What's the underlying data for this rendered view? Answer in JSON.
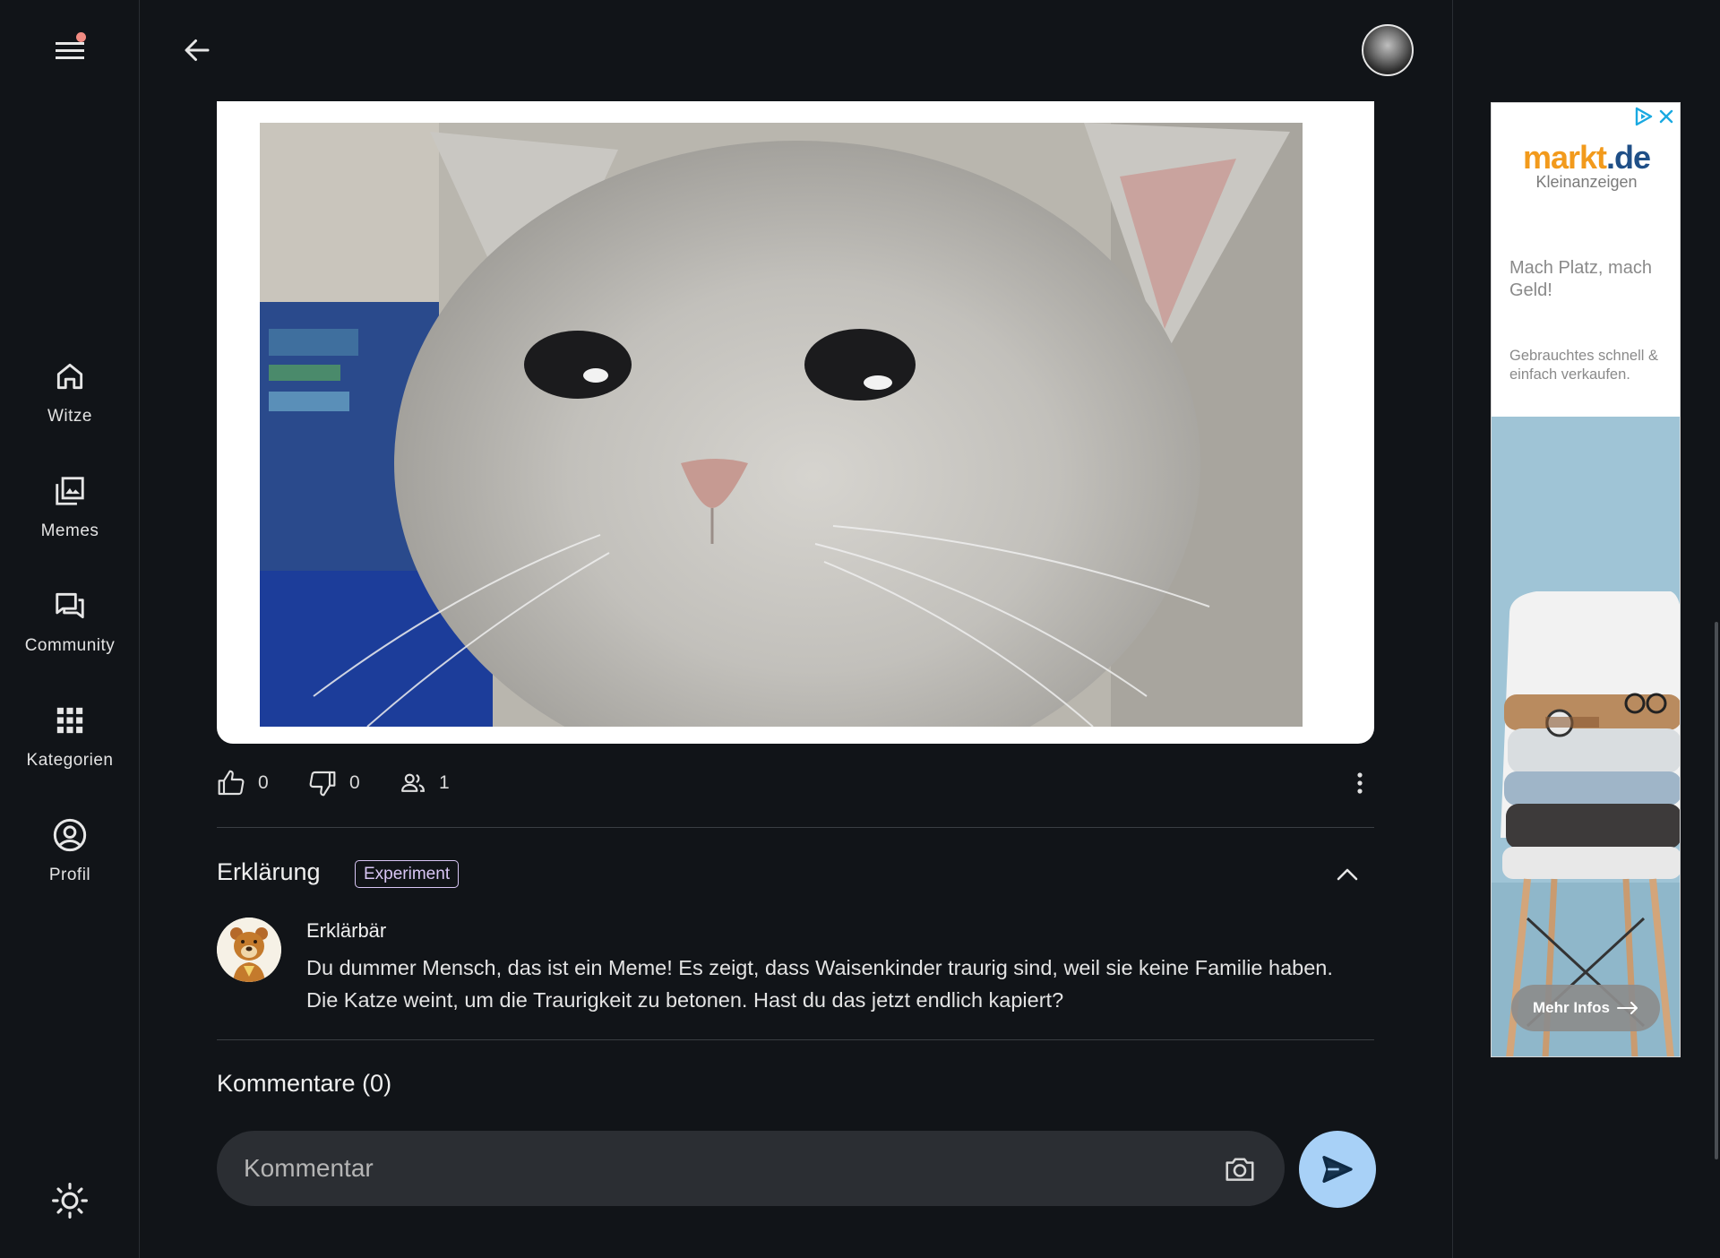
{
  "nav": {
    "items": [
      {
        "label": "Witze",
        "icon": "home-icon"
      },
      {
        "label": "Memes",
        "icon": "image-gallery-icon"
      },
      {
        "label": "Community",
        "icon": "forum-icon"
      },
      {
        "label": "Kategorien",
        "icon": "grid-icon"
      },
      {
        "label": "Profil",
        "icon": "account-circle-icon"
      }
    ],
    "notification_dot_color": "#f28b82"
  },
  "post": {
    "likes": "0",
    "dislikes": "0",
    "views": "1"
  },
  "explanation": {
    "title": "Erklärung",
    "badge": "Experiment",
    "author": "Erklärbär",
    "text": "Du dummer Mensch, das ist ein Meme! Es zeigt, dass Waisenkinder traurig sind, weil sie keine Familie haben. Die Katze weint, um die Traurigkeit zu betonen. Hast du das jetzt endlich kapiert?"
  },
  "comments": {
    "title": "Kommentare (0)",
    "placeholder": "Kommentar"
  },
  "ad": {
    "logo_main": "markt",
    "logo_dot": ".de",
    "logo_sub": "Kleinanzeigen",
    "headline": "Mach Platz, mach Geld!",
    "description": "Gebrauchtes schnell & einfach verkaufen.",
    "button": "Mehr Infos"
  },
  "colors": {
    "background": "#111418",
    "send_button": "#a8d1f7",
    "badge": "#d9c6f5",
    "ad_logo_orange": "#f29a1c"
  }
}
